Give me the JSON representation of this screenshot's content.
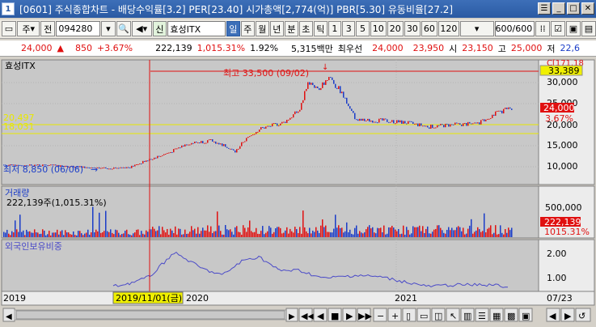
{
  "window": {
    "number": "1",
    "title": "[0601] 주식종합차트 - 배당수익률[3.2] PER[23.40] 시가총액[2,774(억)] PBR[5.30] 유동비율[27.2]"
  },
  "toolbar": {
    "market": "주",
    "prev": "전",
    "code": "094280",
    "credit_badge": "신",
    "stock_name": "효성ITX",
    "periods": [
      "일",
      "주",
      "월",
      "년",
      "분",
      "초",
      "틱"
    ],
    "period_selected": "일",
    "multipliers": [
      "1",
      "3",
      "5",
      "10",
      "20",
      "30",
      "60",
      "120"
    ],
    "count": "600/600"
  },
  "quote": {
    "price": "24,000",
    "change": "850",
    "change_pct": "+3.67%",
    "volume": "222,139",
    "volume_ratio": "1,015.31%",
    "turnover": "1.92%",
    "amount": "5,315백만",
    "best_sell_label": "최우선",
    "ask": "24,000",
    "bid": "23,950",
    "open_label": "시",
    "open": "23,150",
    "high_label": "고",
    "high": "25,000",
    "low_label": "저",
    "low": "22,6"
  },
  "price_pane": {
    "title": "효성ITX",
    "max_label": "최고 33,500 (09/02)",
    "min_label": "최저 8,850 (06/06)",
    "line1": "20,497",
    "line2": "18,031",
    "current_price": "24,000",
    "current_pct": "3.67%",
    "crosshair_value": "33,389",
    "y_ticks": [
      "30,000",
      "25,000",
      "20,000",
      "15,000",
      "10,000"
    ],
    "top_tick": "C[171.18"
  },
  "volume_pane": {
    "title": "거래량",
    "info": "222,139주(1,015.31%)",
    "y_ticks": [
      "500,000",
      "0"
    ],
    "current": "222,139",
    "current_pct": "1015.31%"
  },
  "foreign_pane": {
    "title": "외국인보유비중",
    "y_ticks": [
      "2.00",
      "1.00"
    ]
  },
  "xaxis": {
    "labels": [
      "2019",
      "2020",
      "2021",
      "07/23"
    ],
    "crosshair_date": "2019/11/01(금)"
  },
  "colors": {
    "up": "#e01010",
    "down": "#1a3cc8",
    "guide": "#e8e800",
    "bg": "#c8c8c8"
  }
}
